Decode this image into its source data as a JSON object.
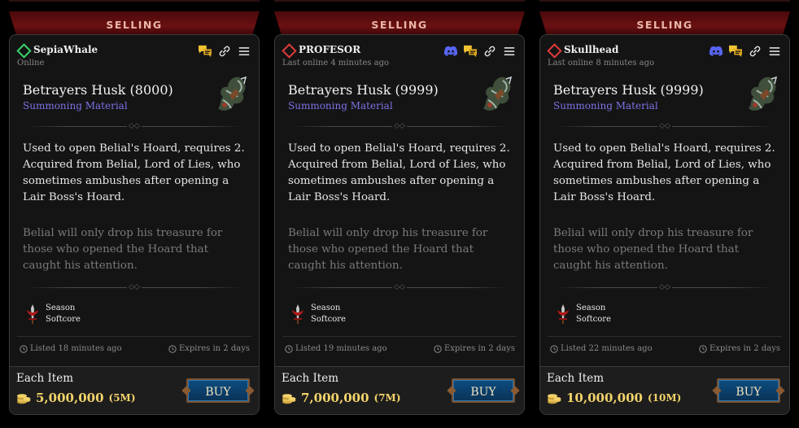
{
  "listings": [
    {
      "banner": "SELLING",
      "seller": "SepiaWhale",
      "status_color": "#3ad26a",
      "online_text": "Online",
      "show_discord": false,
      "item_name": "Betrayers Husk (8000)",
      "item_type": "Summoning Material",
      "description": "Used to open Belial's Hoard, requires 2. Acquired from Belial, Lord of Lies, who sometimes ambushes after opening a Lair Boss's Hoard.",
      "flavor": "Belial will only drop his treasure for those who opened the Hoard that caught his attention.",
      "league_line1": "Season",
      "league_line2": "Softcore",
      "listed": "Listed 18 minutes ago",
      "expires": "Expires in 2 days",
      "each_item": "Each Item",
      "price": "5,000,000",
      "price_short": "(5M)",
      "buy_label": "BUY"
    },
    {
      "banner": "SELLING",
      "seller": "PROFESOR",
      "status_color": "#e03a3a",
      "online_text": "Last online 4 minutes ago",
      "show_discord": true,
      "item_name": "Betrayers Husk (9999)",
      "item_type": "Summoning Material",
      "description": "Used to open Belial's Hoard, requires 2. Acquired from Belial, Lord of Lies, who sometimes ambushes after opening a Lair Boss's Hoard.",
      "flavor": "Belial will only drop his treasure for those who opened the Hoard that caught his attention.",
      "league_line1": "Season",
      "league_line2": "Softcore",
      "listed": "Listed 19 minutes ago",
      "expires": "Expires in 2 days",
      "each_item": "Each Item",
      "price": "7,000,000",
      "price_short": "(7M)",
      "buy_label": "BUY"
    },
    {
      "banner": "SELLING",
      "seller": "Skullhead",
      "status_color": "#e03a3a",
      "online_text": "Last online 8 minutes ago",
      "show_discord": true,
      "item_name": "Betrayers Husk (9999)",
      "item_type": "Summoning Material",
      "description": "Used to open Belial's Hoard, requires 2. Acquired from Belial, Lord of Lies, who sometimes ambushes after opening a Lair Boss's Hoard.",
      "flavor": "Belial will only drop his treasure for those who opened the Hoard that caught his attention.",
      "league_line1": "Season",
      "league_line2": "Softcore",
      "listed": "Listed 22 minutes ago",
      "expires": "Expires in 2 days",
      "each_item": "Each Item",
      "price": "10,000,000",
      "price_short": "(10M)",
      "buy_label": "BUY"
    }
  ],
  "colors": {
    "accent_purple": "#7d73e6",
    "gold": "#f3d36b",
    "discord": "#5865f2",
    "chat": "#f1c232"
  },
  "icons": [
    "status-diamond-icon",
    "discord-icon",
    "chat-icon",
    "link-icon",
    "menu-icon",
    "item-husk-icon",
    "league-sword-icon",
    "clock-icon",
    "coins-icon"
  ]
}
